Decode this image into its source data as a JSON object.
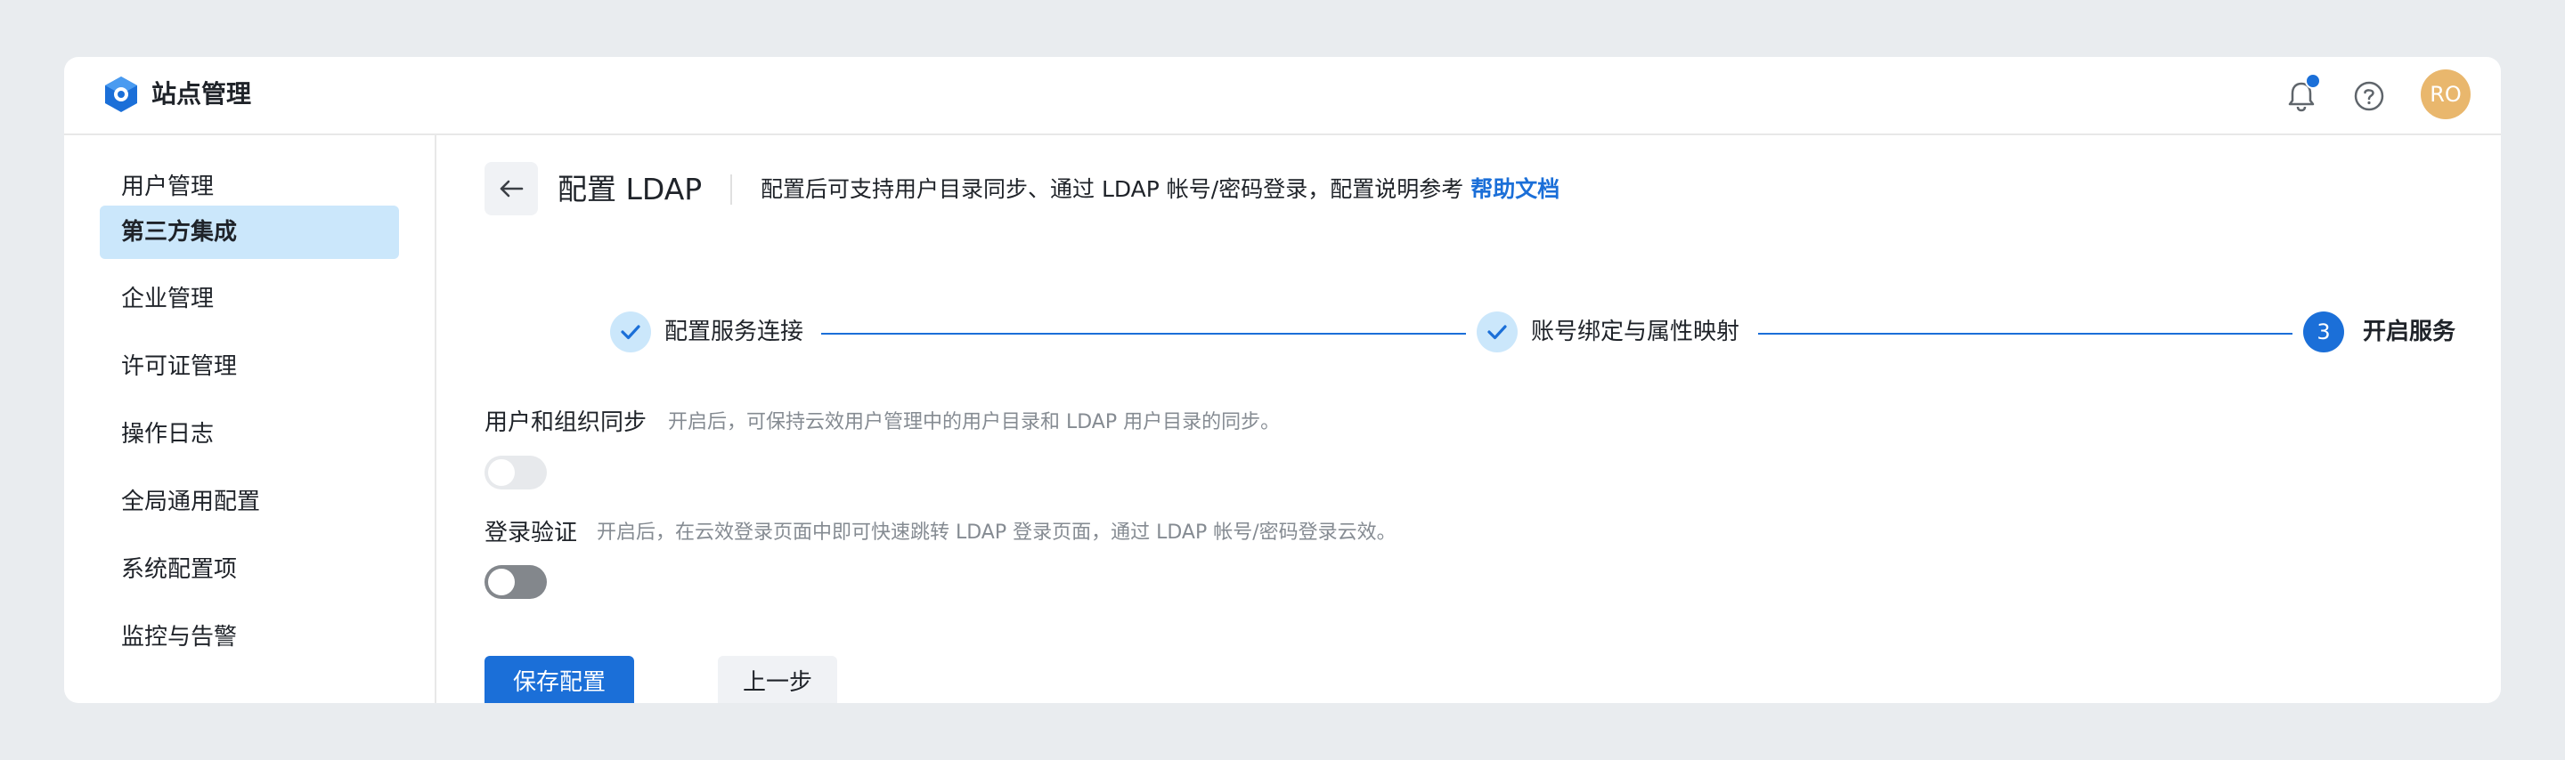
{
  "header": {
    "app_title": "站点管理",
    "logo_icon": "hexagon-logo-icon",
    "bell_icon": "bell-icon",
    "help_icon": "question-circle-icon",
    "avatar_text": "RO",
    "avatar_color": "#e9b76d",
    "accent_color": "#1b6fd8"
  },
  "sidebar": {
    "items": [
      {
        "label": "用户管理",
        "active": false
      },
      {
        "label": "第三方集成",
        "active": true
      },
      {
        "label": "企业管理",
        "active": false
      },
      {
        "label": "许可证管理",
        "active": false
      },
      {
        "label": "操作日志",
        "active": false
      },
      {
        "label": "全局通用配置",
        "active": false
      },
      {
        "label": "系统配置项",
        "active": false
      },
      {
        "label": "监控与告警",
        "active": false
      }
    ]
  },
  "page": {
    "back_icon": "arrow-left-icon",
    "title": "配置 LDAP",
    "description": "配置后可支持用户目录同步、通过 LDAP 帐号/密码登录，配置说明参考",
    "help_link": "帮助文档"
  },
  "steps": [
    {
      "label": "配置服务连接",
      "state": "done",
      "icon": "check-icon"
    },
    {
      "label": "账号绑定与属性映射",
      "state": "done",
      "icon": "check-icon"
    },
    {
      "label": "开启服务",
      "state": "current",
      "number": "3"
    }
  ],
  "sections": {
    "sync": {
      "title": "用户和组织同步",
      "description": "开启后，可保持云效用户管理中的用户目录和 LDAP 用户目录的同步。",
      "enabled": false
    },
    "login": {
      "title": "登录验证",
      "description": "开启后，在云效登录页面中即可快速跳转 LDAP 登录页面，通过 LDAP 帐号/密码登录云效。",
      "enabled": false
    }
  },
  "actions": {
    "save_label": "保存配置",
    "prev_label": "上一步"
  }
}
